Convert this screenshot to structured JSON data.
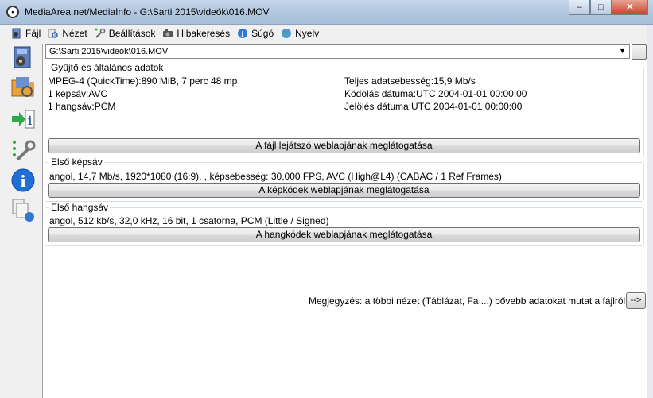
{
  "window": {
    "title": "MediaArea.net/MediaInfo - G:\\Sarti 2015\\videók\\016.MOV",
    "icon_glyph": "((•))",
    "minimize": "–",
    "maximize": "□",
    "close": "✕"
  },
  "menu": [
    {
      "label": "Fájl",
      "icon": "file-open-icon"
    },
    {
      "label": "Nézet",
      "icon": "view-icon"
    },
    {
      "label": "Beállítások",
      "icon": "settings-icon"
    },
    {
      "label": "Hibakeresés",
      "icon": "debug-icon"
    },
    {
      "label": "Súgó",
      "icon": "help-icon"
    },
    {
      "label": "Nyelv",
      "icon": "language-icon"
    }
  ],
  "sidebar": [
    {
      "name": "open-file-icon"
    },
    {
      "name": "open-folder-icon"
    },
    {
      "name": "export-info-icon"
    },
    {
      "name": "preferences-icon"
    },
    {
      "name": "about-icon"
    },
    {
      "name": "sheets-icon"
    }
  ],
  "file_selector": {
    "value": "G:\\Sarti 2015\\videók\\016.MOV",
    "arrow": "▼",
    "browse_label": "..."
  },
  "general": {
    "title": "Gyűjtő és általános adatok",
    "left": [
      "MPEG-4 (QuickTime):890 MiB, 7 perc 48 mp",
      "1 képsáv:AVC",
      "1 hangsáv:PCM"
    ],
    "right": [
      "Teljes adatsebesség:15,9 Mb/s",
      "Kódolás dátuma:UTC 2004-01-01 00:00:00",
      "Jelölés dátuma:UTC 2004-01-01 00:00:00"
    ],
    "button": "A fájl lejátszó weblapjának meglátogatása"
  },
  "video": {
    "title": "Első képsáv",
    "info": "angol, 14,7 Mb/s, 1920*1080 (16:9), , képsebesség: 30,000 FPS, AVC (High@L4) (CABAC / 1 Ref Frames)",
    "button": "A képkódek weblapjának meglátogatása"
  },
  "audio": {
    "title": "Első hangsáv",
    "info": "angol, 512 kb/s, 32,0 kHz, 16 bit, 1 csatorna, PCM (Little / Signed)",
    "button": "A hangkódek weblapjának meglátogatása"
  },
  "note": {
    "text": "Megjegyzés: a többi nézet (Táblázat, Fa ...) bővebb adatokat mutat a fájlról",
    "button": "-->"
  }
}
